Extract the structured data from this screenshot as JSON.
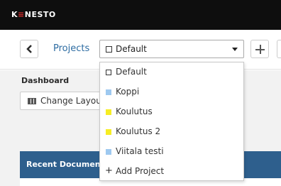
{
  "app": {
    "logo_prefix": "K",
    "logo_accent": "≡",
    "logo_suffix": "NESTO"
  },
  "nav": {
    "back_icon": "chevron-left-icon",
    "projects_label": "Projects",
    "add_icon": "plus-icon"
  },
  "project_select": {
    "value": "Default"
  },
  "dashboard": {
    "title": "Dashboard",
    "change_layout_label": "Change Layout"
  },
  "recent": {
    "header": "Recent Documents"
  },
  "dropdown": {
    "items": [
      {
        "label": "Default",
        "color": "#ffffff",
        "outline": true
      },
      {
        "label": "Koppi",
        "color": "#9ec9f0"
      },
      {
        "label": "Koulutus",
        "color": "#f6ed24"
      },
      {
        "label": "Koulutus 2",
        "color": "#f6ed24"
      },
      {
        "label": "Viitala testi",
        "color": "#9ec9f0"
      }
    ],
    "add_label": "Add Project",
    "add_symbol": "+"
  },
  "colors": {
    "topbar": "#0e0e0e",
    "logo_accent": "#d62b2b",
    "link": "#2d6ca2",
    "panel_header": "#2e5f8d"
  }
}
